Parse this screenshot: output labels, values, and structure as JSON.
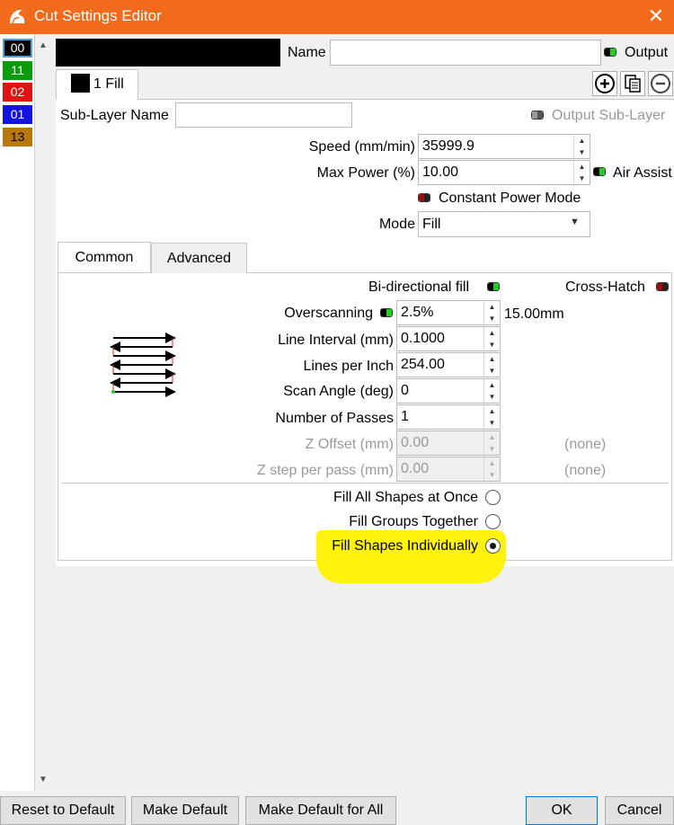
{
  "window": {
    "title": "Cut Settings Editor",
    "close_label": "✕"
  },
  "layers": [
    {
      "label": "00",
      "color": "#000000"
    },
    {
      "label": "11",
      "color": "#0c9b0c"
    },
    {
      "label": "02",
      "color": "#e11212"
    },
    {
      "label": "01",
      "color": "#1414e0"
    },
    {
      "label": "13",
      "color": "#b8780c"
    }
  ],
  "scroll": {
    "up": "▲",
    "down": "▼"
  },
  "header": {
    "name_label": "Name",
    "name_value": "",
    "output_label": "Output",
    "output_on": true
  },
  "sublayer_tab": {
    "label": "1 Fill"
  },
  "sublayer": {
    "name_label": "Sub-Layer Name",
    "name_value": "",
    "output_label": "Output Sub-Layer"
  },
  "settings": {
    "speed_label": "Speed (mm/min)",
    "speed_value": "35999.9",
    "max_power_label": "Max Power (%)",
    "max_power_value": "10.00",
    "air_assist_label": "Air Assist",
    "air_assist_on": true,
    "constant_power_label": "Constant Power Mode",
    "constant_power_on": false,
    "mode_label": "Mode",
    "mode_value": "Fill"
  },
  "tabs": [
    {
      "label": "Common",
      "active": true
    },
    {
      "label": "Advanced",
      "active": false
    }
  ],
  "common": {
    "bidir_label": "Bi-directional fill",
    "bidir_on": true,
    "crosshatch_label": "Cross-Hatch",
    "crosshatch_on": false,
    "overscan_label": "Overscanning",
    "overscan_on": true,
    "overscan_value": "2.5%",
    "overscan_mm": "15.00mm",
    "line_interval_label": "Line Interval (mm)",
    "line_interval_value": "0.1000",
    "lpi_label": "Lines per Inch",
    "lpi_value": "254.00",
    "scan_angle_label": "Scan Angle (deg)",
    "scan_angle_value": "0",
    "passes_label": "Number of Passes",
    "passes_value": "1",
    "z_offset_label": "Z Offset (mm)",
    "z_offset_value": "0.00",
    "z_offset_note": "(none)",
    "z_step_label": "Z step per pass (mm)",
    "z_step_value": "0.00",
    "z_step_note": "(none)"
  },
  "fill_options": [
    {
      "label": "Fill All Shapes at Once",
      "selected": false
    },
    {
      "label": "Fill Groups Together",
      "selected": false
    },
    {
      "label": "Fill Shapes Individually",
      "selected": true
    }
  ],
  "highlight_color": "#fff100",
  "buttons": {
    "reset": "Reset to Default",
    "make_default": "Make Default",
    "make_default_all": "Make Default for All",
    "ok": "OK",
    "cancel": "Cancel"
  }
}
